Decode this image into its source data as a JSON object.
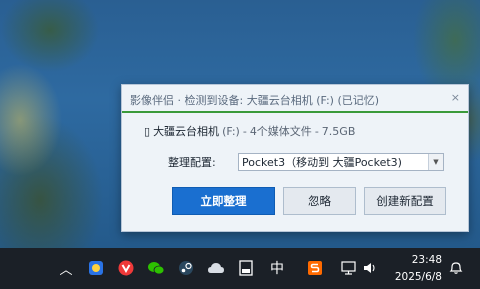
{
  "dialog": {
    "title": "影像伴侣 · 检测到设备: 大疆云台相机 (F:) (已记忆)",
    "close_glyph": "×",
    "device_icon_glyph": "▯",
    "device_name": "大疆云台相机",
    "device_drive": "(F:)",
    "device_sep1": "-",
    "device_count": "4个媒体文件",
    "device_sep2": "-",
    "device_size": "7.5GB",
    "config_label": "整理配置:",
    "config_value": "Pocket3（移动到 大疆Pocket3)",
    "buttons": {
      "organize": "立即整理",
      "ignore": "忽略",
      "new_config": "创建新配置"
    }
  },
  "taskbar": {
    "chevron": "︿",
    "ime_label": "中",
    "time": "23:48",
    "date": "2025/6/8"
  }
}
